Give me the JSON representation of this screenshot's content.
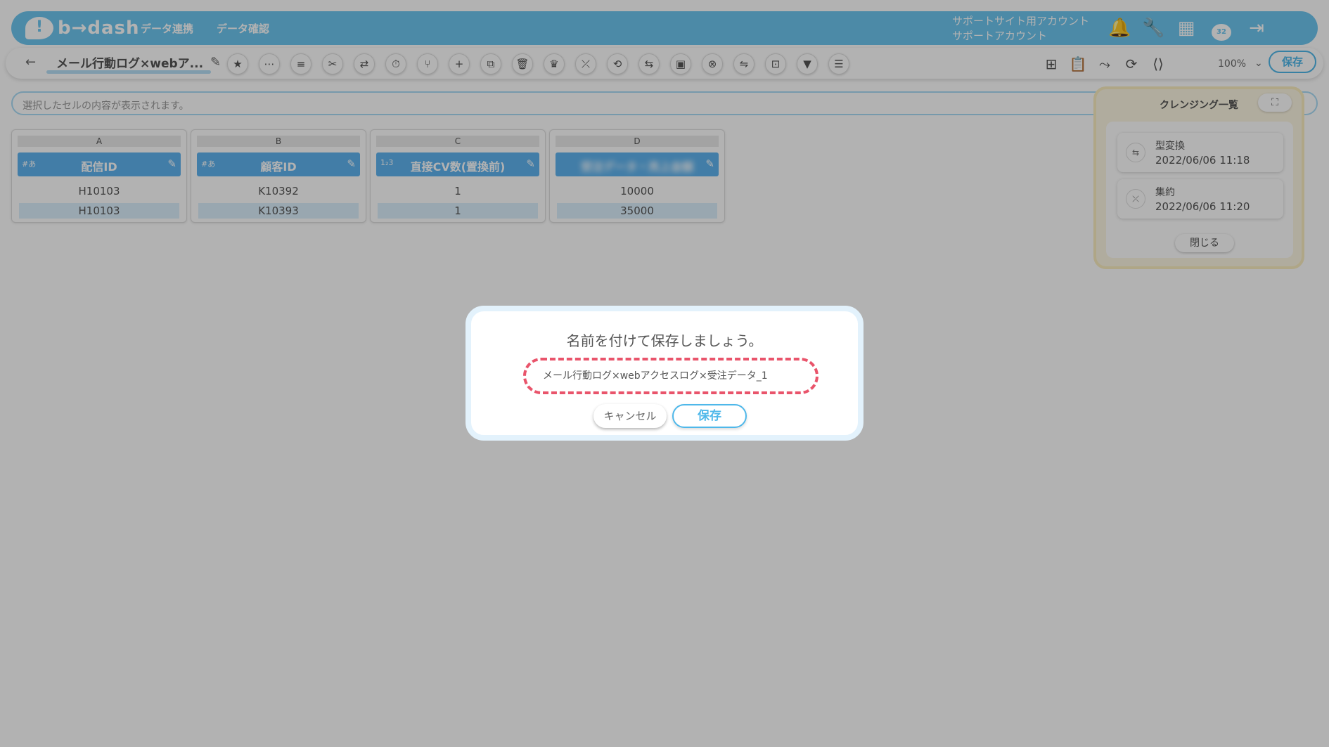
{
  "header": {
    "logo_text": "b→dash",
    "nav": [
      "データ連携",
      "データ確認"
    ],
    "account_line1": "サポートサイト用アカウント",
    "account_line2": "サポートアカウント",
    "notification_badge": "32"
  },
  "toolbar": {
    "file_title": "メール行動ログ×webア...",
    "zoom": "100%",
    "save_label": "保存"
  },
  "cellbar": {
    "placeholder": "選択したセルの内容が表示されます。"
  },
  "table": {
    "columns": [
      {
        "letter": "A",
        "type": "#あ",
        "name": "配信ID",
        "values": [
          "H10103",
          "H10103"
        ]
      },
      {
        "letter": "B",
        "type": "#あ",
        "name": "顧客ID",
        "values": [
          "K10392",
          "K10393"
        ]
      },
      {
        "letter": "C",
        "type": "1₂3",
        "name": "直接CV数(置換前)",
        "values": [
          "1",
          "1"
        ]
      },
      {
        "letter": "D",
        "type": "",
        "name": "受注データ・売上金額",
        "values": [
          "10000",
          "35000"
        ]
      }
    ]
  },
  "cleansing_panel": {
    "title": "クレンジング一覧",
    "history": [
      {
        "name": "型変換",
        "time": "2022/06/06 11:18"
      },
      {
        "name": "集約",
        "time": "2022/06/06 11:20"
      }
    ],
    "close_label": "閉じる"
  },
  "modal": {
    "title": "名前を付けて保存しましょう。",
    "name_value": "メール行動ログ×webアクセスログ×受注データ_1",
    "cancel_label": "キャンセル",
    "save_label": "保存"
  },
  "colors": {
    "brand": "#6ec6f0",
    "accent": "#4fb8ea",
    "highlight_dashed": "#e9546b",
    "column_header": "#5fb4f0"
  }
}
